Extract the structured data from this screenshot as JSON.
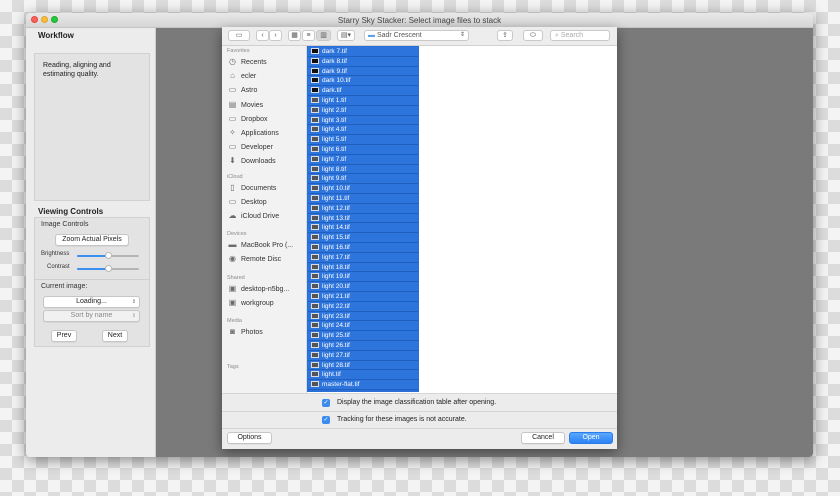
{
  "window": {
    "title": "Starry Sky Stacker: Select image files to stack"
  },
  "left_panel": {
    "workflow_title": "Workflow",
    "workflow_text": "Reading, aligning and estimating quality.",
    "viewing_controls_title": "Viewing Controls",
    "image_controls_label": "Image Controls",
    "zoom_button": "Zoom Actual Pixels",
    "brightness_label": "Brightness",
    "brightness_value": 0.5,
    "contrast_label": "Contrast",
    "contrast_value": 0.5,
    "current_image_label": "Current image:",
    "current_image_select": "Loading...",
    "sort_select": "Sort by name",
    "prev_button": "Prev",
    "next_button": "Next"
  },
  "dialog": {
    "location": "Sadr Crescent",
    "search_placeholder": "Search",
    "sidebar": {
      "favorites_header": "Favorites",
      "favorites": [
        {
          "label": "Recents",
          "icon": "clock-icon"
        },
        {
          "label": "ecler",
          "icon": "home-icon"
        },
        {
          "label": "Astro",
          "icon": "folder-icon"
        },
        {
          "label": "Movies",
          "icon": "film-icon"
        },
        {
          "label": "Dropbox",
          "icon": "folder-icon"
        },
        {
          "label": "Applications",
          "icon": "applications-icon"
        },
        {
          "label": "Developer",
          "icon": "folder-icon"
        },
        {
          "label": "Downloads",
          "icon": "download-icon"
        }
      ],
      "icloud_header": "iCloud",
      "icloud": [
        {
          "label": "Documents",
          "icon": "document-icon"
        },
        {
          "label": "Desktop",
          "icon": "desktop-icon"
        },
        {
          "label": "iCloud Drive",
          "icon": "cloud-icon"
        }
      ],
      "devices_header": "Devices",
      "devices": [
        {
          "label": "MacBook Pro (...",
          "icon": "laptop-icon"
        },
        {
          "label": "Remote Disc",
          "icon": "disc-icon"
        }
      ],
      "shared_header": "Shared",
      "shared": [
        {
          "label": "desktop-n5bg...",
          "icon": "monitor-icon"
        },
        {
          "label": "workgroup",
          "icon": "monitor-icon"
        }
      ],
      "media_header": "Media",
      "media": [
        {
          "label": "Photos",
          "icon": "camera-icon"
        }
      ],
      "tags_header": "Tags"
    },
    "files": [
      "dark 7.tif",
      "dark 8.tif",
      "dark 9.tif",
      "dark 10.tif",
      "dark.tif",
      "light 1.tif",
      "light 2.tif",
      "light 3.tif",
      "light 4.tif",
      "light 5.tif",
      "light 6.tif",
      "light 7.tif",
      "light 8.tif",
      "light 9.tif",
      "light 10.tif",
      "light 11.tif",
      "light 12.tif",
      "light 13.tif",
      "light 14.tif",
      "light 15.tif",
      "light 16.tif",
      "light 17.tif",
      "light 18.tif",
      "light 19.tif",
      "light 20.tif",
      "light 21.tif",
      "light 22.tif",
      "light 23.tif",
      "light 24.tif",
      "light 25.tif",
      "light 26.tif",
      "light 27.tif",
      "light 28.tif",
      "light.tif",
      "master-flat.tif"
    ],
    "option1": "Display the image classification table after opening.",
    "option2": "Tracking for these images is not accurate.",
    "options_button": "Options",
    "cancel_button": "Cancel",
    "open_button": "Open"
  }
}
